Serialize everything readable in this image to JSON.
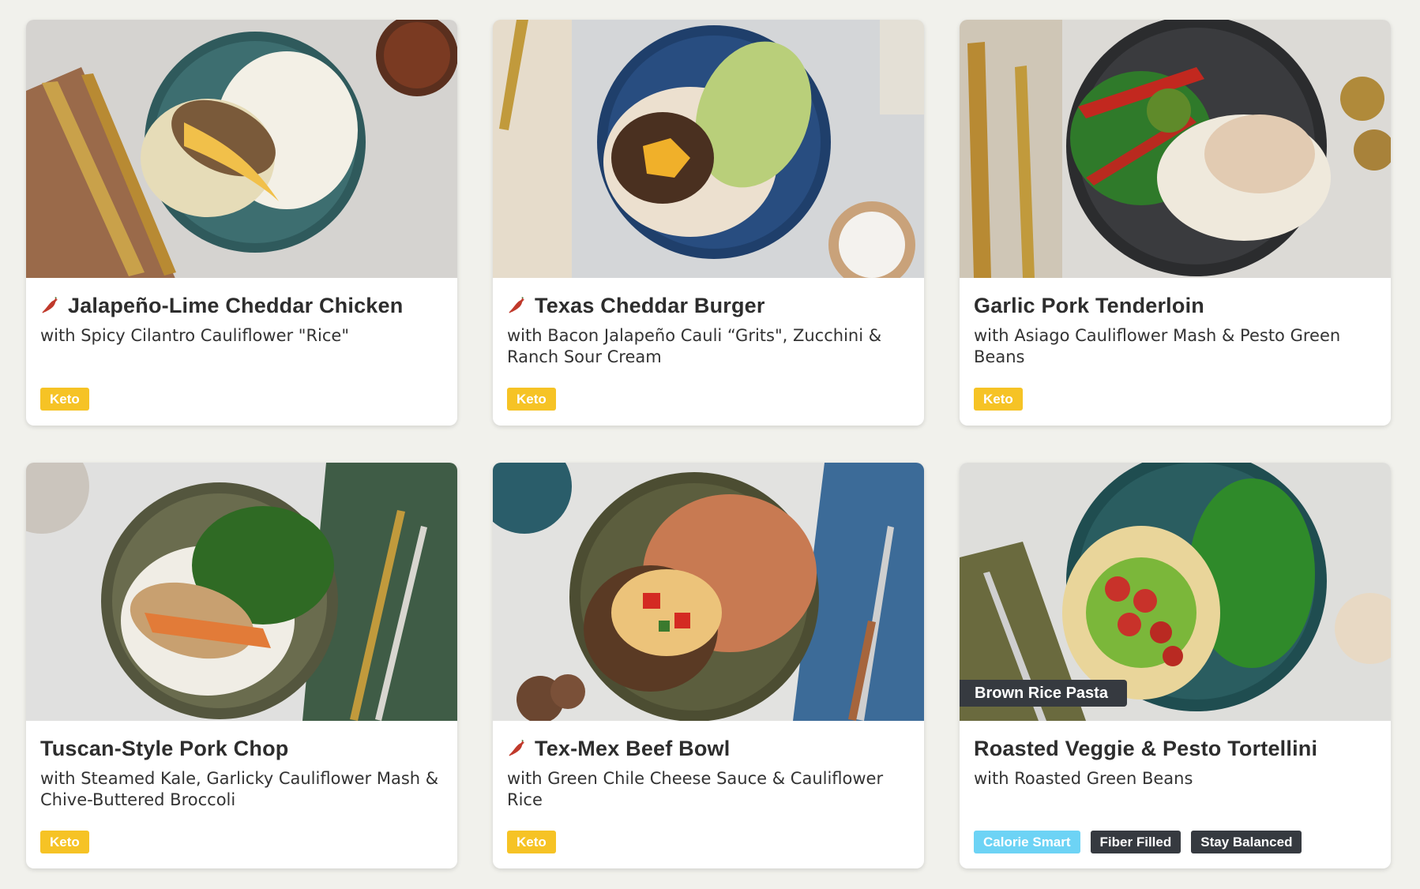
{
  "colors": {
    "page_background": "#f1f1ec",
    "keto_tag": "#f6c325",
    "calorie_smart_tag": "#6dd3f5",
    "dark_tag": "#363a40",
    "chili_icon": "#c0392b"
  },
  "recipes": [
    {
      "title": "Jalapeño-Lime Cheddar Chicken",
      "subtitle": "with Spicy Cilantro Cauliflower \"Rice\"",
      "spicy": true,
      "tags": [
        "Keto"
      ]
    },
    {
      "title": "Texas Cheddar Burger",
      "subtitle": "with Bacon Jalapeño Cauli “Grits\", Zucchini & Ranch Sour Cream",
      "spicy": true,
      "tags": [
        "Keto"
      ]
    },
    {
      "title": "Garlic Pork Tenderloin",
      "subtitle": "with Asiago Cauliflower Mash & Pesto Green Beans",
      "spicy": false,
      "tags": [
        "Keto"
      ]
    },
    {
      "title": "Tuscan-Style Pork Chop",
      "subtitle": "with Steamed Kale, Garlicky Cauliflower Mash & Chive-Buttered Broccoli",
      "spicy": false,
      "tags": [
        "Keto"
      ]
    },
    {
      "title": "Tex-Mex Beef Bowl",
      "subtitle": "with Green Chile Cheese Sauce & Cauliflower Rice",
      "spicy": true,
      "tags": [
        "Keto"
      ]
    },
    {
      "title": "Roasted Veggie & Pesto Tortellini",
      "subtitle": "with Roasted Green Beans",
      "spicy": false,
      "photo_badge": "Brown Rice Pasta",
      "tags": [
        "Calorie Smart",
        "Fiber Filled",
        "Stay Balanced"
      ]
    }
  ]
}
